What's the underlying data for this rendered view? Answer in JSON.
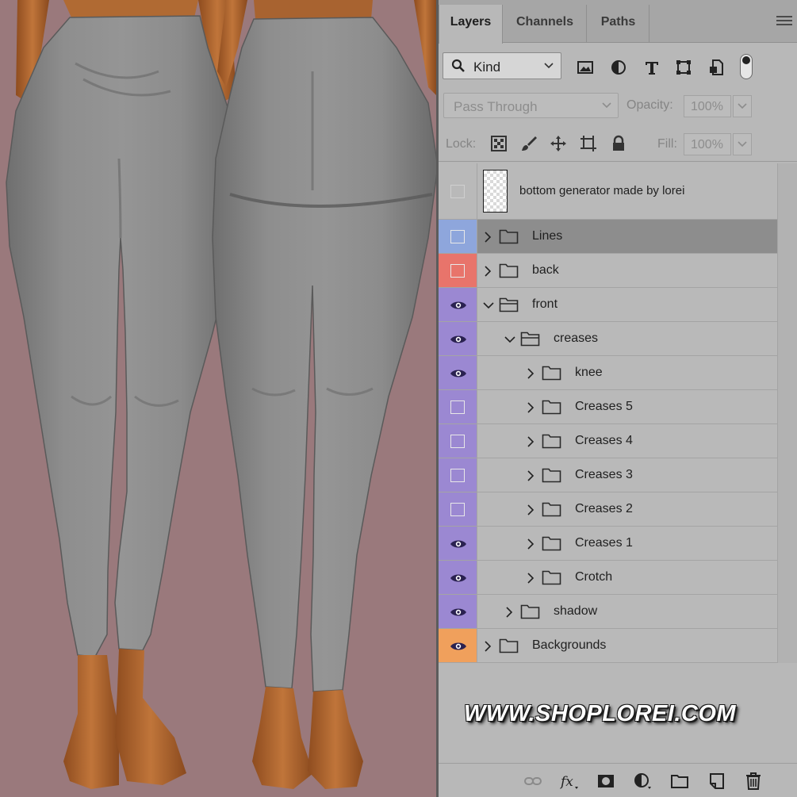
{
  "panel": {
    "tabs": [
      {
        "label": "Layers",
        "active": true
      },
      {
        "label": "Channels",
        "active": false
      },
      {
        "label": "Paths",
        "active": false
      }
    ],
    "filter": {
      "kind_label": "Kind"
    },
    "blend_mode": "Pass Through",
    "opacity_label": "Opacity:",
    "opacity_value": "100%",
    "lock_label": "Lock:",
    "fill_label": "Fill:",
    "fill_value": "100%"
  },
  "layers": [
    {
      "name": "bottom generator made by lorei",
      "type": "layer",
      "visible": false,
      "color": "none"
    },
    {
      "name": "Lines",
      "type": "group",
      "visible": false,
      "color": "#8ea6dc",
      "expanded": false,
      "selected": true
    },
    {
      "name": "back",
      "type": "group",
      "visible": false,
      "color": "#e8746b",
      "expanded": false
    },
    {
      "name": "front",
      "type": "group",
      "visible": true,
      "color": "#9b88d2",
      "expanded": true
    },
    {
      "name": "creases",
      "type": "group",
      "visible": true,
      "color": "#9b88d2",
      "expanded": true
    },
    {
      "name": "knee",
      "type": "group",
      "visible": true,
      "color": "#9b88d2",
      "expanded": false
    },
    {
      "name": "Creases 5",
      "type": "group",
      "visible": false,
      "color": "#9b88d2",
      "expanded": false
    },
    {
      "name": "Creases 4",
      "type": "group",
      "visible": false,
      "color": "#9b88d2",
      "expanded": false
    },
    {
      "name": "Creases 3",
      "type": "group",
      "visible": false,
      "color": "#9b88d2",
      "expanded": false
    },
    {
      "name": "Creases 2",
      "type": "group",
      "visible": false,
      "color": "#9b88d2",
      "expanded": false
    },
    {
      "name": "Creases 1",
      "type": "group",
      "visible": true,
      "color": "#9b88d2",
      "expanded": false
    },
    {
      "name": "Crotch",
      "type": "group",
      "visible": true,
      "color": "#9b88d2",
      "expanded": false
    },
    {
      "name": "shadow",
      "type": "group",
      "visible": true,
      "color": "#9b88d2",
      "expanded": false
    },
    {
      "name": "Backgrounds",
      "type": "group",
      "visible": true,
      "color": "#f0a05c",
      "expanded": false
    }
  ],
  "watermark": "WWW.SHOPLOREI.COM",
  "icons": {
    "filter": [
      "image-filter-icon",
      "adjustment-filter-icon",
      "type-filter-icon",
      "shape-filter-icon",
      "smart-object-filter-icon"
    ],
    "lock": [
      "lock-transparent-icon",
      "lock-paint-icon",
      "lock-position-icon",
      "lock-artboard-icon",
      "lock-all-icon"
    ],
    "footer": [
      "link-layers-icon",
      "fx-icon",
      "add-mask-icon",
      "new-adjustment-icon",
      "new-group-icon",
      "new-layer-icon",
      "delete-layer-icon"
    ]
  },
  "colors": {
    "canvas_bg": "#9a797c",
    "pants": "#8a8a8a",
    "skin": "#b3672e",
    "panel_bg": "#b8b8b8"
  }
}
